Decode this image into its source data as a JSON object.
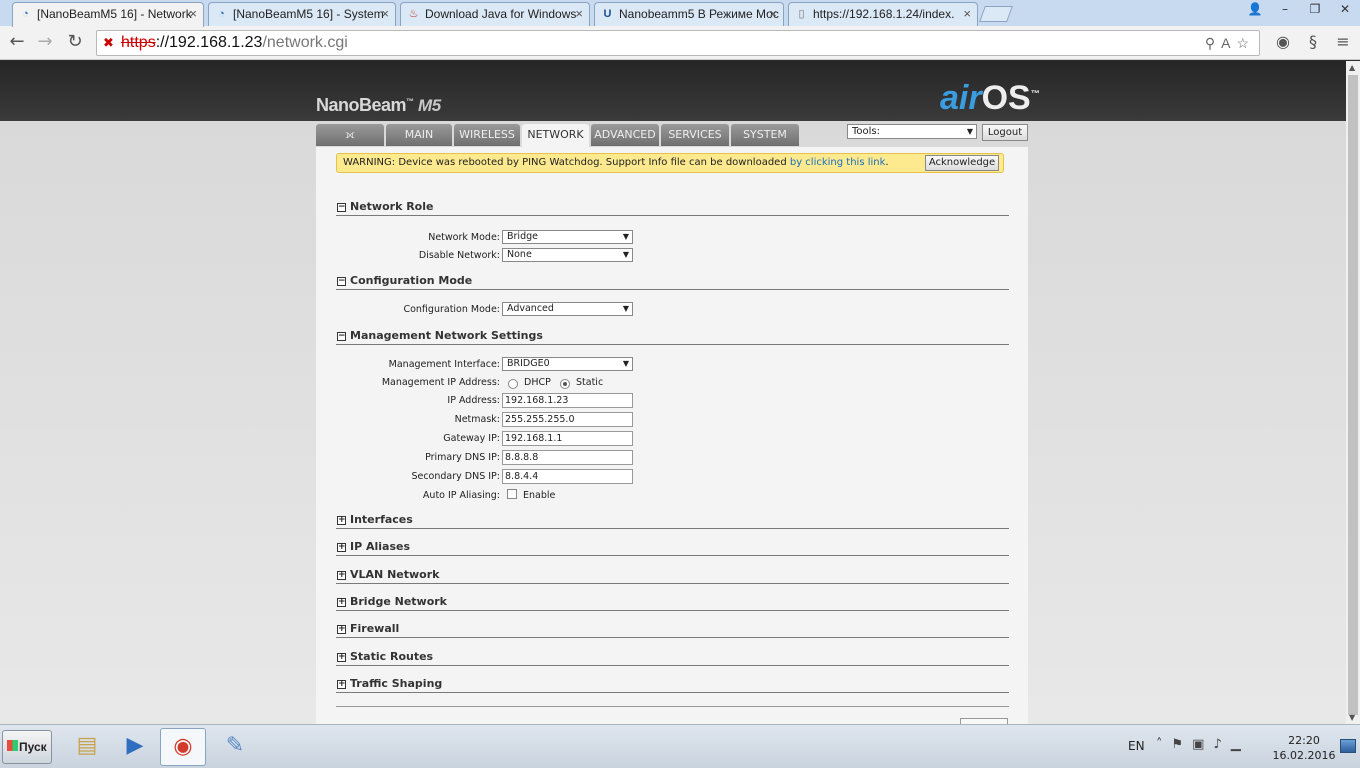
{
  "browser": {
    "tabs": [
      {
        "title": "[NanoBeamM5 16] - Network",
        "icon": "signal-icon",
        "active": true
      },
      {
        "title": "[NanoBeamM5 16] - System",
        "icon": "signal-icon",
        "active": false
      },
      {
        "title": "Download Java for Windows",
        "icon": "java-icon",
        "active": false
      },
      {
        "title": "Nanobeamm5 В Режиме Мос",
        "icon": "ubiquiti-icon",
        "active": false
      },
      {
        "title": "https://192.168.1.24/index.",
        "icon": "page-icon",
        "active": false
      }
    ],
    "url": {
      "scheme": "https",
      "host": "://192.168.1.23",
      "path": "/network.cgi"
    }
  },
  "header": {
    "brand": "NanoBeam",
    "brand_tm": "™",
    "brand_model": "M5",
    "logo_air": "air",
    "logo_os": "OS",
    "logo_tm": "™",
    "tabs": [
      "MAIN",
      "WIRELESS",
      "NETWORK",
      "ADVANCED",
      "SERVICES",
      "SYSTEM"
    ],
    "active_tab": "NETWORK",
    "tools_label": "Tools:",
    "logout_label": "Logout"
  },
  "warning": {
    "text": "WARNING: Device was rebooted by PING Watchdog. Support Info file can be downloaded ",
    "link": "by clicking this link",
    "end": ".",
    "button": "Acknowledge"
  },
  "sections": {
    "network_role": {
      "title": "Network Role",
      "network_mode_label": "Network Mode:",
      "network_mode": "Bridge",
      "disable_network_label": "Disable Network:",
      "disable_network": "None"
    },
    "configuration_mode": {
      "title": "Configuration Mode",
      "mode_label": "Configuration Mode:",
      "mode": "Advanced"
    },
    "management": {
      "title": "Management Network Settings",
      "interface_label": "Management Interface:",
      "interface": "BRIDGE0",
      "ip_mode_label": "Management IP Address:",
      "dhcp_label": "DHCP",
      "static_label": "Static",
      "ip_mode": "Static",
      "ip_label": "IP Address:",
      "ip": "192.168.1.23",
      "netmask_label": "Netmask:",
      "netmask": "255.255.255.0",
      "gateway_label": "Gateway IP:",
      "gateway": "192.168.1.1",
      "dns1_label": "Primary DNS IP:",
      "dns1": "8.8.8.8",
      "dns2_label": "Secondary DNS IP:",
      "dns2": "8.8.4.4",
      "alias_label": "Auto IP Aliasing:",
      "alias_enable_label": "Enable",
      "alias_enabled": false
    },
    "collapsed": [
      "Interfaces",
      "IP Aliases",
      "VLAN Network",
      "Bridge Network",
      "Firewall",
      "Static Routes",
      "Traffic Shaping"
    ]
  },
  "taskbar": {
    "start_label": "Пуск",
    "language": "EN",
    "time": "22:20",
    "date": "16.02.2016"
  }
}
